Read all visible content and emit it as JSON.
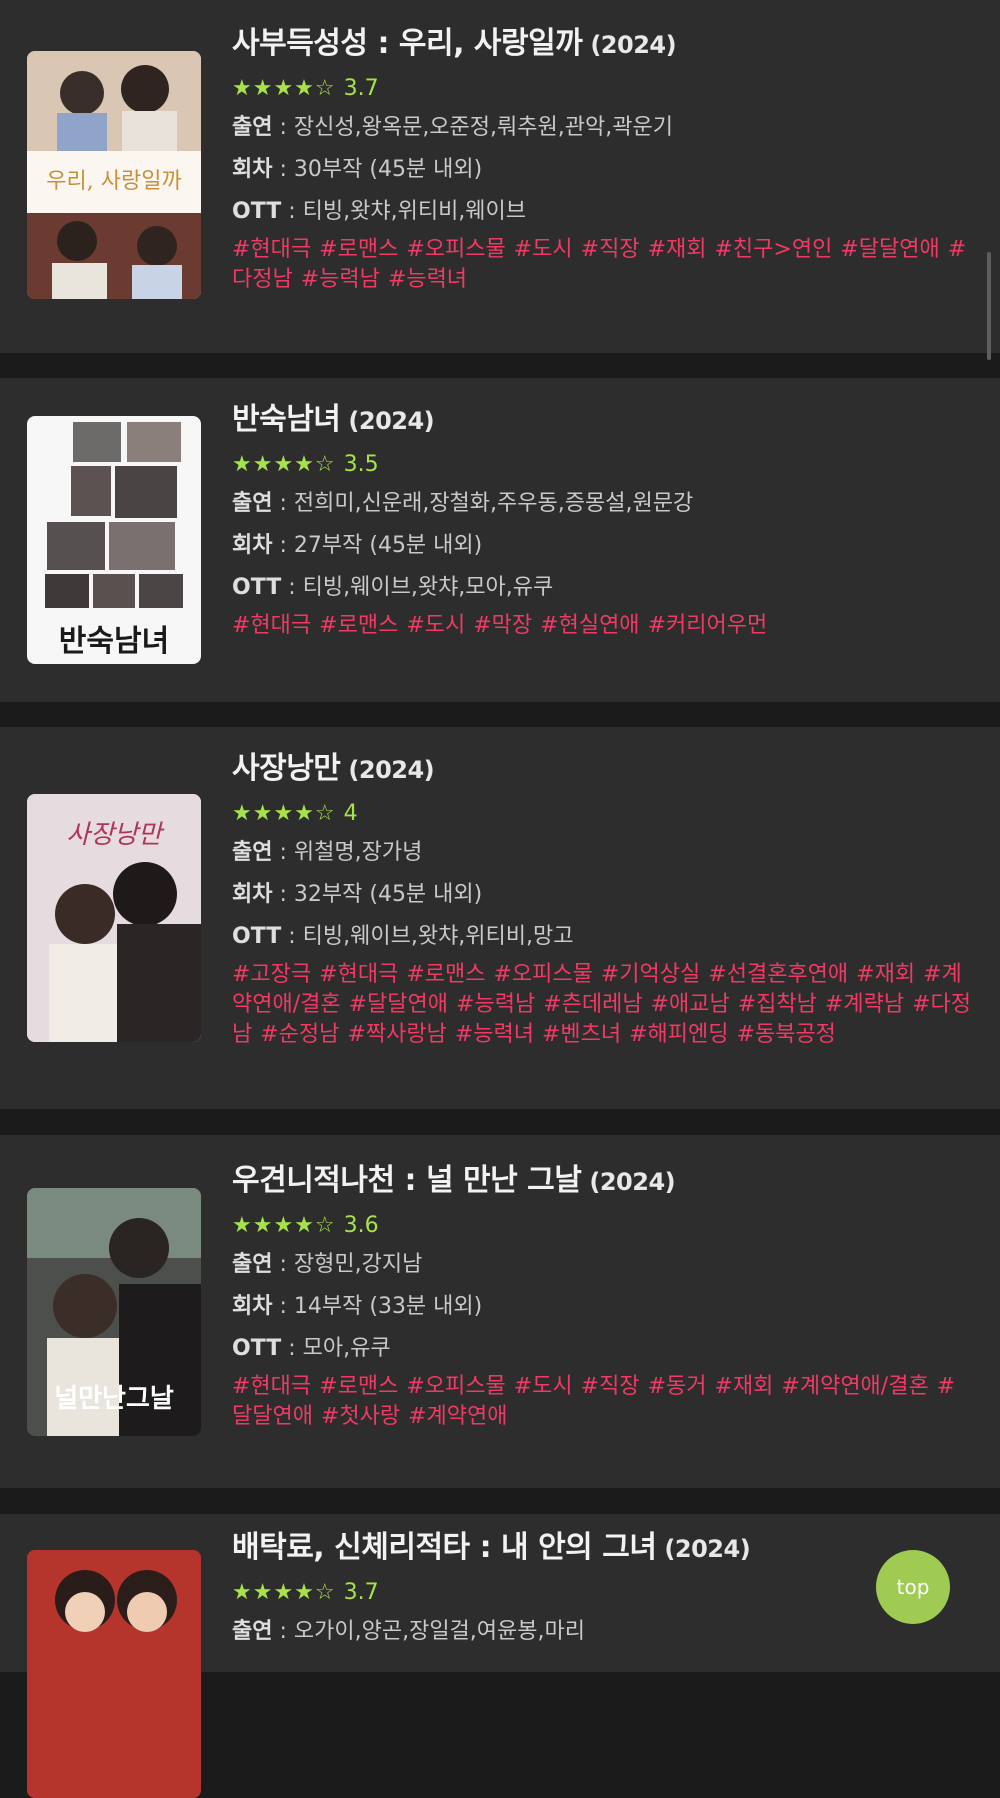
{
  "dramas": [
    {
      "title": "사부득성성 : 우리, 사랑일까",
      "year": "(2024)",
      "stars": "★★★★☆",
      "score": "3.7",
      "cast_label": "출연",
      "cast": "장신성,왕옥문,오준정,뤄추원,관악,곽운기",
      "episodes_label": "회차",
      "episodes": "30부작 (45분 내외)",
      "ott_label": "OTT",
      "ott": "티빙,왓챠,위티비,웨이브",
      "poster_text": "우리, 사랑일까",
      "tags": [
        "#현대극",
        "#로맨스",
        "#오피스물",
        "#도시",
        "#직장",
        "#재회",
        "#친구>연인",
        "#달달연애",
        "#다정남",
        "#능력남",
        "#능력녀"
      ]
    },
    {
      "title": "반숙남녀",
      "year": "(2024)",
      "stars": "★★★★☆",
      "score": "3.5",
      "cast_label": "출연",
      "cast": "전희미,신운래,장철화,주우동,증몽설,원문강",
      "episodes_label": "회차",
      "episodes": "27부작 (45분 내외)",
      "ott_label": "OTT",
      "ott": "티빙,웨이브,왓챠,모아,유쿠",
      "poster_text": "반숙남녀",
      "tags": [
        "#현대극",
        "#로맨스",
        "#도시",
        "#막장",
        "#현실연애",
        "#커리어우먼"
      ]
    },
    {
      "title": "사장낭만",
      "year": "(2024)",
      "stars": "★★★★☆",
      "score": "4",
      "cast_label": "출연",
      "cast": "위철명,장가녕",
      "episodes_label": "회차",
      "episodes": "32부작 (45분 내외)",
      "ott_label": "OTT",
      "ott": "티빙,웨이브,왓챠,위티비,망고",
      "poster_text": "사장낭만",
      "tags": [
        "#고장극",
        "#현대극",
        "#로맨스",
        "#오피스물",
        "#기억상실",
        "#선결혼후연애",
        "#재회",
        "#계약연애/결혼",
        "#달달연애",
        "#능력남",
        "#츤데레남",
        "#애교남",
        "#집착남",
        "#계략남",
        "#다정남",
        "#순정남",
        "#짝사랑남",
        "#능력녀",
        "#벤츠녀",
        "#해피엔딩",
        "#동북공정"
      ]
    },
    {
      "title": "우견니적나천 : 널 만난 그날",
      "year": "(2024)",
      "stars": "★★★★☆",
      "score": "3.6",
      "cast_label": "출연",
      "cast": "장형민,강지남",
      "episodes_label": "회차",
      "episodes": "14부작 (33분 내외)",
      "ott_label": "OTT",
      "ott": "모아,유쿠",
      "poster_text": "널만난그날",
      "tags": [
        "#현대극",
        "#로맨스",
        "#오피스물",
        "#도시",
        "#직장",
        "#동거",
        "#재회",
        "#계약연애/결혼",
        "#달달연애",
        "#첫사랑",
        "#계약연애"
      ]
    },
    {
      "title": "배탁료, 신체리적타 : 내 안의 그녀",
      "year": "(2024)",
      "stars": "★★★★☆",
      "score": "3.7",
      "cast_label": "출연",
      "cast": "오가이,양곤,장일걸,여윤봉,마리",
      "poster_text": ""
    }
  ],
  "top_button": "top",
  "colors": {
    "background": "#1b1b1b",
    "card": "#2d2d2d",
    "star": "#a7e24a",
    "tag": "#f03a64",
    "top_button": "#9fcb52"
  }
}
